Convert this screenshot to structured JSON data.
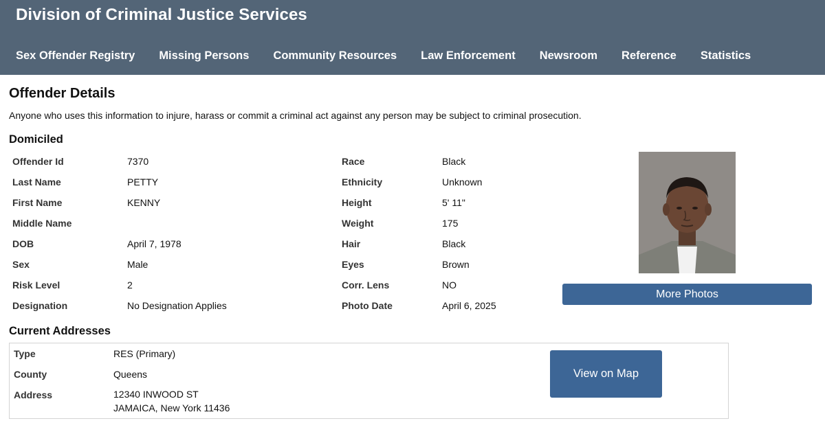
{
  "header": {
    "title": "Division of Criminal Justice Services",
    "nav": [
      "Sex Offender Registry",
      "Missing Persons",
      "Community Resources",
      "Law Enforcement",
      "Newsroom",
      "Reference",
      "Statistics"
    ]
  },
  "page": {
    "title": "Offender Details",
    "warning": "Anyone who uses this information to injure, harass or commit a criminal act against any person may be subject to criminal prosecution.",
    "status": "Domiciled"
  },
  "details_left": [
    {
      "label": "Offender Id",
      "value": "7370"
    },
    {
      "label": "Last Name",
      "value": "PETTY"
    },
    {
      "label": "First Name",
      "value": "KENNY"
    },
    {
      "label": "Middle Name",
      "value": ""
    },
    {
      "label": "DOB",
      "value": "April 7, 1978"
    },
    {
      "label": "Sex",
      "value": "Male"
    },
    {
      "label": "Risk Level",
      "value": "2"
    },
    {
      "label": "Designation",
      "value": "No Designation Applies"
    }
  ],
  "details_right": [
    {
      "label": "Race",
      "value": "Black"
    },
    {
      "label": "Ethnicity",
      "value": "Unknown"
    },
    {
      "label": "Height",
      "value": "5' 11\""
    },
    {
      "label": "Weight",
      "value": "175"
    },
    {
      "label": "Hair",
      "value": "Black"
    },
    {
      "label": "Eyes",
      "value": "Brown"
    },
    {
      "label": "Corr. Lens",
      "value": "NO"
    },
    {
      "label": "Photo Date",
      "value": "April 6, 2025"
    }
  ],
  "photo": {
    "more_photos_label": "More Photos"
  },
  "addresses": {
    "heading": "Current Addresses",
    "type_label": "Type",
    "type_value": "RES (Primary)",
    "county_label": "County",
    "county_value": "Queens",
    "address_label": "Address",
    "address_line1": "12340 INWOOD ST",
    "address_line2": "JAMAICA, New York 11436",
    "map_button": "View on Map"
  },
  "colors": {
    "header_bg": "#536577",
    "button_bg": "#3d6696"
  }
}
